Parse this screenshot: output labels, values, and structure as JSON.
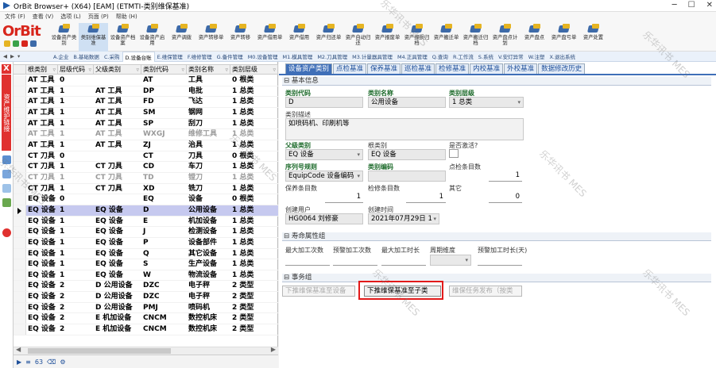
{
  "window": {
    "title": "OrBit Browser+ (X64) [EAM] (ETMTI-类别维保基准)",
    "controls": [
      "─",
      "☐",
      "✕"
    ]
  },
  "menubar": {
    "items": [
      "文件 (F)",
      "查看 (V)",
      "选项 (L)",
      "页面 (P)",
      "帮助 (H)"
    ]
  },
  "logo": {
    "text": "OrBit",
    "color": "#d8261c"
  },
  "toolbar": {
    "items": [
      {
        "label": "设备资产类别",
        "active": false
      },
      {
        "label": "类别维保基准",
        "active": true
      },
      {
        "label": "设备资产档案",
        "active": false
      },
      {
        "label": "设备资产启用",
        "active": false
      },
      {
        "label": "资产调拨",
        "active": false
      },
      {
        "label": "资产转移单",
        "active": false
      },
      {
        "label": "资产转移",
        "active": false
      },
      {
        "label": "资产借用单",
        "active": false
      },
      {
        "label": "资产借用",
        "active": false
      },
      {
        "label": "资产归还单",
        "active": false
      },
      {
        "label": "资产自动归还",
        "active": false
      },
      {
        "label": "资产报废单",
        "active": false
      },
      {
        "label": "资产报损归档",
        "active": false
      },
      {
        "label": "资产搬迁单",
        "active": false
      },
      {
        "label": "资产搬迁归档",
        "active": false
      },
      {
        "label": "资产盘点计划",
        "active": false
      },
      {
        "label": "资产盘点",
        "active": false
      },
      {
        "label": "资产盘亏单",
        "active": false
      },
      {
        "label": "资产处置",
        "active": false
      }
    ]
  },
  "modules": {
    "nav": [
      "◀",
      "▶",
      "▾"
    ],
    "items": [
      {
        "label": "A.企业",
        "sel": false
      },
      {
        "label": "B.基础数据",
        "sel": false
      },
      {
        "label": "C.采购",
        "sel": false
      },
      {
        "label": "D.设备台账",
        "sel": true
      },
      {
        "label": "E.维保管理",
        "sel": false
      },
      {
        "label": "F.维修管理",
        "sel": false
      },
      {
        "label": "G.备件管理",
        "sel": false
      },
      {
        "label": "M0.设备管理",
        "sel": false
      },
      {
        "label": "M1.模具管理",
        "sel": false
      },
      {
        "label": "M2.刀具管理",
        "sel": false
      },
      {
        "label": "M3.计量器具管理",
        "sel": false
      },
      {
        "label": "M4.正具管理",
        "sel": false
      },
      {
        "label": "Q.查询",
        "sel": false
      },
      {
        "label": "R.工作流",
        "sel": false
      },
      {
        "label": "S.系统",
        "sel": false
      },
      {
        "label": "V.安灯异常",
        "sel": false
      },
      {
        "label": "W.注塑",
        "sel": false
      },
      {
        "label": "X.退出系统",
        "sel": false
      }
    ]
  },
  "sidebar": {
    "close": "X",
    "label": "资产维护链接"
  },
  "grid": {
    "headers": [
      "根类别",
      "层级代码",
      "父级类别",
      "类别代码",
      "类别名称",
      "类别层级"
    ],
    "rows": [
      {
        "cells": [
          "AT 工具",
          "0",
          "",
          "AT",
          "工具",
          "0 根类"
        ],
        "gray": false,
        "sel": false
      },
      {
        "cells": [
          "AT 工具",
          "1",
          "AT 工具",
          "DP",
          "电批",
          "1 总类"
        ],
        "gray": false,
        "sel": false
      },
      {
        "cells": [
          "AT 工具",
          "1",
          "AT 工具",
          "FD",
          "飞达",
          "1 总类"
        ],
        "gray": false,
        "sel": false
      },
      {
        "cells": [
          "AT 工具",
          "1",
          "AT 工具",
          "SM",
          "钢网",
          "1 总类"
        ],
        "gray": false,
        "sel": false
      },
      {
        "cells": [
          "AT 工具",
          "1",
          "AT 工具",
          "SP",
          "刮刀",
          "1 总类"
        ],
        "gray": false,
        "sel": false
      },
      {
        "cells": [
          "AT 工具",
          "1",
          "AT 工具",
          "WXGJ",
          "维修工具",
          "1 总类"
        ],
        "gray": true,
        "sel": false
      },
      {
        "cells": [
          "AT 工具",
          "1",
          "AT 工具",
          "ZJ",
          "治具",
          "1 总类"
        ],
        "gray": false,
        "sel": false
      },
      {
        "cells": [
          "CT 刀具",
          "0",
          "",
          "CT",
          "刀具",
          "0 根类"
        ],
        "gray": false,
        "sel": false
      },
      {
        "cells": [
          "CT 刀具",
          "1",
          "CT 刀具",
          "CD",
          "车刀",
          "1 总类"
        ],
        "gray": false,
        "sel": false
      },
      {
        "cells": [
          "CT 刀具",
          "1",
          "CT 刀具",
          "TD",
          "镗刀",
          "1 总类"
        ],
        "gray": true,
        "sel": false
      },
      {
        "cells": [
          "CT 刀具",
          "1",
          "CT 刀具",
          "XD",
          "铣刀",
          "1 总类"
        ],
        "gray": false,
        "sel": false
      },
      {
        "cells": [
          "EQ 设备",
          "0",
          "",
          "EQ",
          "设备",
          "0 根类"
        ],
        "gray": false,
        "sel": false
      },
      {
        "cells": [
          "EQ 设备",
          "1",
          "EQ 设备",
          "D",
          "公用设备",
          "1 总类"
        ],
        "gray": false,
        "sel": true
      },
      {
        "cells": [
          "EQ 设备",
          "1",
          "EQ 设备",
          "E",
          "机加设备",
          "1 总类"
        ],
        "gray": false,
        "sel": false
      },
      {
        "cells": [
          "EQ 设备",
          "1",
          "EQ 设备",
          "J",
          "检测设备",
          "1 总类"
        ],
        "gray": false,
        "sel": false
      },
      {
        "cells": [
          "EQ 设备",
          "1",
          "EQ 设备",
          "P",
          "设备部件",
          "1 总类"
        ],
        "gray": false,
        "sel": false
      },
      {
        "cells": [
          "EQ 设备",
          "1",
          "EQ 设备",
          "Q",
          "其它设备",
          "1 总类"
        ],
        "gray": false,
        "sel": false
      },
      {
        "cells": [
          "EQ 设备",
          "1",
          "EQ 设备",
          "S",
          "生产设备",
          "1 总类"
        ],
        "gray": false,
        "sel": false
      },
      {
        "cells": [
          "EQ 设备",
          "1",
          "EQ 设备",
          "W",
          "物流设备",
          "1 总类"
        ],
        "gray": false,
        "sel": false
      },
      {
        "cells": [
          "EQ 设备",
          "2",
          "D 公用设备",
          "DZC",
          "电子秤",
          "2 类型"
        ],
        "gray": false,
        "sel": false
      },
      {
        "cells": [
          "EQ 设备",
          "2",
          "D 公用设备",
          "DZC",
          "电子秤",
          "2 类型"
        ],
        "gray": false,
        "sel": false
      },
      {
        "cells": [
          "EQ 设备",
          "2",
          "D 公用设备",
          "PMJ",
          "喷码机",
          "2 类型"
        ],
        "gray": false,
        "sel": false
      },
      {
        "cells": [
          "EQ 设备",
          "2",
          "E 机加设备",
          "CNCM",
          "数控机床",
          "2 类型"
        ],
        "gray": false,
        "sel": false
      },
      {
        "cells": [
          "EQ 设备",
          "2",
          "E 机加设备",
          "CNCM",
          "数控机床",
          "2 类型"
        ],
        "gray": false,
        "sel": false
      }
    ],
    "status": "63"
  },
  "tabs": [
    {
      "label": "设备资产类别",
      "sel": true
    },
    {
      "label": "点检基准",
      "sel": false
    },
    {
      "label": "保养基准",
      "sel": false
    },
    {
      "label": "巡检基准",
      "sel": false
    },
    {
      "label": "检修基准",
      "sel": false
    },
    {
      "label": "内校基准",
      "sel": false
    },
    {
      "label": "外校基准",
      "sel": false
    },
    {
      "label": "数据修改历史",
      "sel": false
    }
  ],
  "form": {
    "group_basic": "基本信息",
    "category_code_label": "类别代码",
    "category_code": "D",
    "category_name_label": "类别名称",
    "category_name": "公用设备",
    "category_level_label": "类别层级",
    "category_level": "1 总类",
    "description_label": "类别描述",
    "description": "如喷码机、印刷机等",
    "parent_label": "父级类别",
    "parent": "EQ 设备",
    "root_label": "根类别",
    "root": "EQ 设备",
    "active_label": "是否激活?",
    "seq_rule_label": "序列号规则",
    "seq_rule": "EquipCode 设备编码",
    "category_coding_label": "类别编码",
    "spot_items_label": "点检条目数",
    "spot_items": "1",
    "maintenance_items_label": "保养条目数",
    "maintenance_items": "1",
    "inspection_items_label": "检修条目数",
    "inspection_items": "1",
    "other_label": "其它",
    "other": "0",
    "created_by_label": "创建用户",
    "created_by": "HG0064 刘修豪",
    "created_time_label": "创建时间",
    "created_time": "2021年07月29日 1",
    "group_life": "寿命属性组",
    "max_count_label": "最大加工次数",
    "warn_count_label": "预警加工次数",
    "max_time_label": "最大加工时长",
    "period_label": "周期维度",
    "warn_time_label": "预警加工时长(天)",
    "group_action": "事务组",
    "btn_push_equipment": "下推维保基准至设备",
    "btn_push_subclass": "下推维保基准至子类",
    "btn_publish": "维保任务发布（按类"
  },
  "watermark": "乐华讯书 MES",
  "colors": {
    "accent": "#3f6fb8",
    "selected_row": "#c6c9ef",
    "highlight": "#e21a1a",
    "required_label": "#1c6a2a"
  }
}
